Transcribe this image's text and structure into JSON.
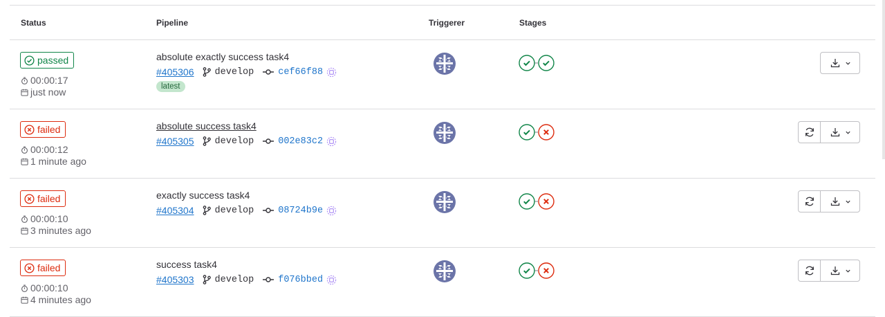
{
  "table": {
    "headers": {
      "status": "Status",
      "pipeline": "Pipeline",
      "triggerer": "Triggerer",
      "stages": "Stages"
    },
    "rows": [
      {
        "status": "passed",
        "duration": "00:00:17",
        "finished": "just now",
        "title": "absolute exactly success task4",
        "id": "#405306",
        "branch": "develop",
        "sha": "cef66f88",
        "tag": "latest",
        "stages": [
          "success",
          "success"
        ],
        "retry": false
      },
      {
        "status": "failed",
        "duration": "00:00:12",
        "finished": "1 minute ago",
        "title": "absolute success task4",
        "id": "#405305",
        "branch": "develop",
        "sha": "002e83c2",
        "tag": "",
        "stages": [
          "success",
          "failed"
        ],
        "retry": true
      },
      {
        "status": "failed",
        "duration": "00:00:10",
        "finished": "3 minutes ago",
        "title": "exactly success task4",
        "id": "#405304",
        "branch": "develop",
        "sha": "08724b9e",
        "tag": "",
        "stages": [
          "success",
          "failed"
        ],
        "retry": true
      },
      {
        "status": "failed",
        "duration": "00:00:10",
        "finished": "4 minutes ago",
        "title": "success task4",
        "id": "#405303",
        "branch": "develop",
        "sha": "f076bbed",
        "tag": "",
        "stages": [
          "success",
          "failed"
        ],
        "retry": true
      }
    ]
  },
  "icons": {
    "status_passed": "check-circle-icon",
    "status_failed": "close-circle-icon",
    "duration": "timer-icon",
    "finished": "calendar-icon",
    "branch": "branch-icon",
    "commit": "commit-icon",
    "signed": "signed-commit-icon",
    "retry": "retry-icon",
    "download": "download-icon",
    "dropdown": "chevron-down-icon"
  },
  "colors": {
    "success": "#108548",
    "failed": "#dd2b0e",
    "link": "#1f75cb",
    "tag_bg": "#c3e6cd"
  }
}
